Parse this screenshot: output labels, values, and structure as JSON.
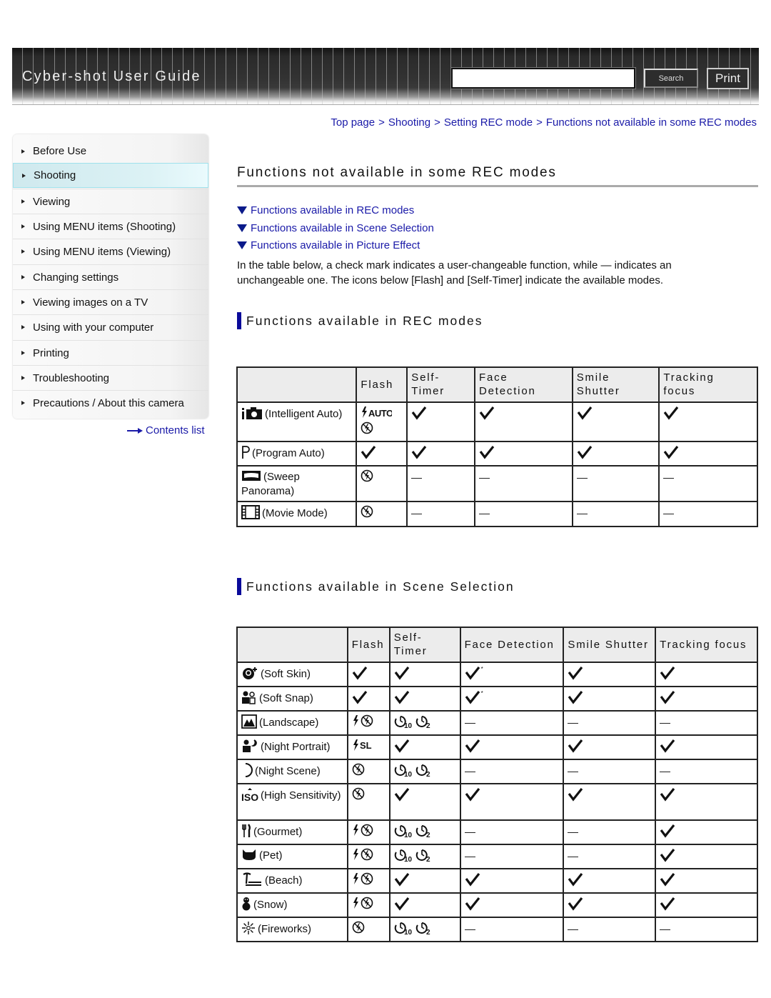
{
  "header": {
    "site_title": "Cyber-shot User Guide",
    "search_placeholder": "",
    "search_value": "",
    "search_button": "Search",
    "print_button": "Print"
  },
  "sidebar": {
    "items": [
      {
        "label": "Before Use",
        "active": false
      },
      {
        "label": "Shooting",
        "active": true
      },
      {
        "label": "Viewing",
        "active": false
      },
      {
        "label": "Using MENU items (Shooting)",
        "active": false
      },
      {
        "label": "Using MENU items (Viewing)",
        "active": false
      },
      {
        "label": "Changing settings",
        "active": false
      },
      {
        "label": "Viewing images on a TV",
        "active": false
      },
      {
        "label": "Using with your computer",
        "active": false
      },
      {
        "label": "Printing",
        "active": false
      },
      {
        "label": "Troubleshooting",
        "active": false
      },
      {
        "label": "Precautions / About this camera",
        "active": false
      }
    ],
    "contents_link": "Contents list"
  },
  "breadcrumb": [
    "Top page",
    "Shooting",
    "Setting REC mode",
    "Functions not available in some REC modes"
  ],
  "breadcrumb_separator": ">",
  "page_title": "Functions not available in some REC modes",
  "anchor_links": [
    "Functions available in REC modes",
    "Functions available in Scene Selection",
    "Functions available in Picture Effect"
  ],
  "intro_text": "In the table below, a check mark indicates a user-changeable function, while — indicates an unchangeable one. The icons below [Flash] and [Self-Timer] indicate the available modes.",
  "colors": {
    "link": "#1a1aa8",
    "section_bar": "#0a0a9a",
    "active_sidebar": "#dcf2f5"
  },
  "rec_modes": {
    "heading": "Functions available in REC modes",
    "columns": [
      "",
      "Flash",
      "Self-Timer",
      "Face Detection",
      "Smile Shutter",
      "Tracking focus"
    ],
    "column_lines": [
      [
        ""
      ],
      [
        "Flash"
      ],
      [
        "Self-",
        "Timer"
      ],
      [
        "Face",
        "Detection"
      ],
      [
        "Smile",
        "Shutter"
      ],
      [
        "Tracking",
        "focus"
      ]
    ],
    "rows": [
      {
        "icon": "intelligent-auto-icon",
        "label": "(Intelligent Auto)",
        "flash": [
          "flash-auto",
          "flash-off"
        ],
        "self_timer": "check",
        "face_detection": "check",
        "smile_shutter": "check",
        "tracking_focus": "check"
      },
      {
        "icon": "program-auto-icon",
        "label": "(Program Auto)",
        "flash": [
          "check"
        ],
        "self_timer": "check",
        "face_detection": "check",
        "smile_shutter": "check",
        "tracking_focus": "check"
      },
      {
        "icon": "sweep-panorama-icon",
        "label": "(Sweep Panorama)",
        "flash": [
          "flash-off"
        ],
        "self_timer": "dash",
        "face_detection": "dash",
        "smile_shutter": "dash",
        "tracking_focus": "dash"
      },
      {
        "icon": "movie-mode-icon",
        "label": "(Movie Mode)",
        "flash": [
          "flash-off"
        ],
        "self_timer": "dash",
        "face_detection": "dash",
        "smile_shutter": "dash",
        "tracking_focus": "dash"
      }
    ]
  },
  "scene_selection": {
    "heading": "Functions available in Scene Selection",
    "columns": [
      "",
      "Flash",
      "Self-Timer",
      "Face Detection",
      "Smile Shutter",
      "Tracking focus"
    ],
    "column_lines": [
      [
        ""
      ],
      [
        "Flash"
      ],
      [
        "Self-",
        "Timer"
      ],
      [
        "Face Detection"
      ],
      [
        "Smile Shutter"
      ],
      [
        "Tracking focus"
      ]
    ],
    "rows": [
      {
        "icon": "soft-skin-icon",
        "label": "(Soft Skin)",
        "flash": [
          "check"
        ],
        "self_timer": [
          "check"
        ],
        "face_detection": "check-star",
        "smile_shutter": "check",
        "tracking_focus": "check"
      },
      {
        "icon": "soft-snap-icon",
        "label": "(Soft Snap)",
        "flash": [
          "check"
        ],
        "self_timer": [
          "check"
        ],
        "face_detection": "check-star",
        "smile_shutter": "check",
        "tracking_focus": "check"
      },
      {
        "icon": "landscape-icon",
        "label": "(Landscape)",
        "flash": [
          "flash-on",
          "flash-off"
        ],
        "self_timer": [
          "timer-10",
          "timer-2"
        ],
        "face_detection": "dash",
        "smile_shutter": "dash",
        "tracking_focus": "dash"
      },
      {
        "icon": "night-portrait-icon",
        "label": "(Night Portrait)",
        "flash": [
          "flash-slow-sync"
        ],
        "self_timer": [
          "check"
        ],
        "face_detection": "check",
        "smile_shutter": "check",
        "tracking_focus": "check"
      },
      {
        "icon": "night-scene-icon",
        "label": "(Night Scene)",
        "flash": [
          "flash-off"
        ],
        "self_timer": [
          "timer-10",
          "timer-2"
        ],
        "face_detection": "dash",
        "smile_shutter": "dash",
        "tracking_focus": "dash"
      },
      {
        "icon": "high-sensitivity-icon",
        "label": "(High Sensitivity)",
        "flash": [
          "flash-off"
        ],
        "self_timer": [
          "check"
        ],
        "face_detection": "check",
        "smile_shutter": "check",
        "tracking_focus": "check"
      },
      {
        "icon": "gourmet-icon",
        "label": "(Gourmet)",
        "flash": [
          "flash-on",
          "flash-off"
        ],
        "self_timer": [
          "timer-10",
          "timer-2"
        ],
        "face_detection": "dash",
        "smile_shutter": "dash",
        "tracking_focus": "check"
      },
      {
        "icon": "pet-icon",
        "label": "(Pet)",
        "flash": [
          "flash-on",
          "flash-off"
        ],
        "self_timer": [
          "timer-10",
          "timer-2"
        ],
        "face_detection": "dash",
        "smile_shutter": "dash",
        "tracking_focus": "check"
      },
      {
        "icon": "beach-icon",
        "label": "(Beach)",
        "flash": [
          "flash-on",
          "flash-off"
        ],
        "self_timer": [
          "check"
        ],
        "face_detection": "check",
        "smile_shutter": "check",
        "tracking_focus": "check"
      },
      {
        "icon": "snow-icon",
        "label": "(Snow)",
        "flash": [
          "flash-on",
          "flash-off"
        ],
        "self_timer": [
          "check"
        ],
        "face_detection": "check",
        "smile_shutter": "check",
        "tracking_focus": "check"
      },
      {
        "icon": "fireworks-icon",
        "label": "(Fireworks)",
        "flash": [
          "flash-off"
        ],
        "self_timer": [
          "timer-10",
          "timer-2"
        ],
        "face_detection": "dash",
        "smile_shutter": "dash",
        "tracking_focus": "dash"
      }
    ]
  }
}
